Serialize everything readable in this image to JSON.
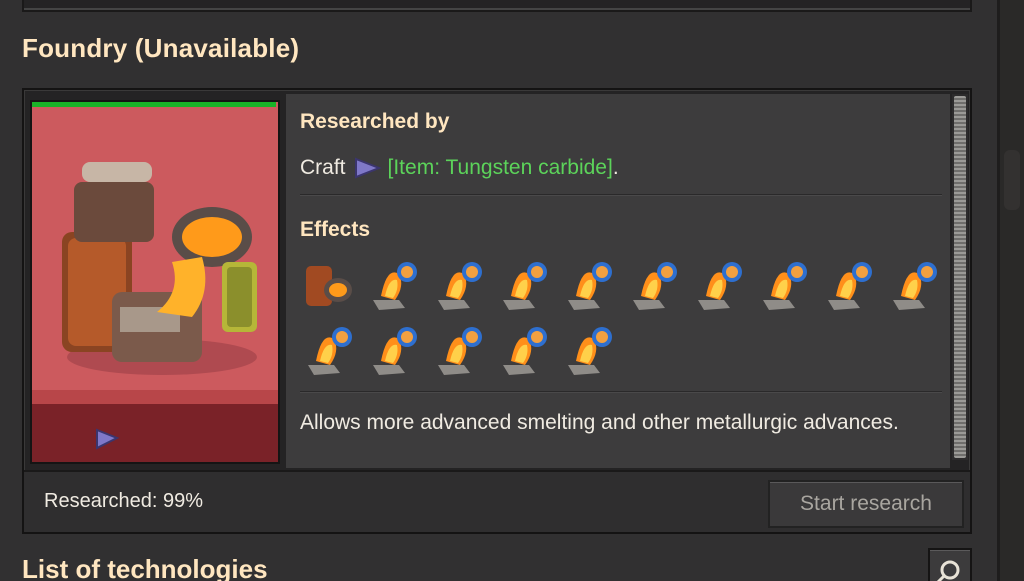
{
  "panel": {
    "title": "Foundry (Unavailable)",
    "progress_fraction": 0.99
  },
  "info": {
    "researched_by_heading": "Researched by",
    "craft_prefix": "Craft",
    "craft_item": "[Item: Tungsten carbide]",
    "craft_suffix": ".",
    "effects_heading": "Effects",
    "effects": [
      "foundry-icon",
      "molten-iron-recipe-icon",
      "molten-copper-recipe-icon",
      "concrete-from-molten-iron-icon",
      "casting-iron-gear-icon",
      "molten-iron-from-lava-icon",
      "molten-copper-from-lava-icon",
      "casting-iron-plate-icon",
      "casting-steel-icon",
      "casting-copper-plate-icon",
      "casting-iron-gear-wheel-icon",
      "casting-iron-stick-icon",
      "casting-pipe-icon",
      "casting-low-density-structure-icon",
      "casting-copper-cable-icon"
    ],
    "description": "Allows more advanced smelting and other metallurgic advances."
  },
  "footer": {
    "researched_label": "Researched: 99%",
    "start_research_label": "Start research"
  },
  "list": {
    "title": "List of technologies"
  },
  "colors": {
    "card_bg": "#cc5a5e",
    "progress_green": "#19b227",
    "item_link_green": "#5cd35a",
    "heading_cream": "#ffe6c0"
  }
}
